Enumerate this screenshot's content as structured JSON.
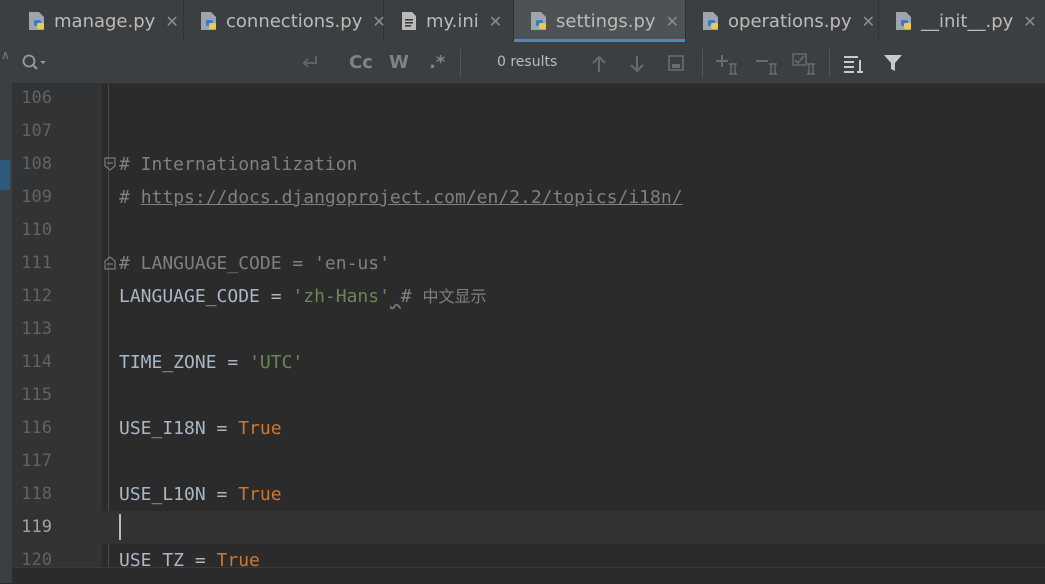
{
  "tabs": [
    {
      "label": "manage.py",
      "icon": "python-file-icon",
      "active": false
    },
    {
      "label": "connections.py",
      "icon": "python-file-icon",
      "active": false
    },
    {
      "label": "my.ini",
      "icon": "text-file-icon",
      "active": false
    },
    {
      "label": "settings.py",
      "icon": "python-file-icon",
      "active": true
    },
    {
      "label": "operations.py",
      "icon": "python-file-icon",
      "active": false
    },
    {
      "label": "__init__.py",
      "icon": "python-file-icon",
      "active": false
    }
  ],
  "search": {
    "results": "0 results",
    "options": {
      "match_case": "Cc",
      "words": "W",
      "regex": ".*"
    }
  },
  "editor": {
    "lines": [
      {
        "num": "106"
      },
      {
        "num": "107"
      },
      {
        "num": "108",
        "comment": "# Internationalization"
      },
      {
        "num": "109",
        "hash": "# ",
        "url": "https://docs.djangoproject.com/en/2.2/topics/i18n/"
      },
      {
        "num": "110"
      },
      {
        "num": "111",
        "comment": "# LANGUAGE_CODE = 'en-us'"
      },
      {
        "num": "112",
        "name": "LANGUAGE_CODE",
        "op": " = ",
        "str": "'zh-Hans'",
        "after": " ",
        "hash": "# ",
        "cjk": "中文显示"
      },
      {
        "num": "113"
      },
      {
        "num": "114",
        "name": "TIME_ZONE",
        "op": " = ",
        "str": "'UTC'"
      },
      {
        "num": "115"
      },
      {
        "num": "116",
        "name": "USE_I18N",
        "op": " = ",
        "kw": "True"
      },
      {
        "num": "117"
      },
      {
        "num": "118",
        "name": "USE_L10N",
        "op": " = ",
        "kw": "True"
      },
      {
        "num": "119"
      },
      {
        "num": "120",
        "name": "USE_TZ",
        "op": " = ",
        "kw": "True"
      }
    ]
  },
  "colors": {
    "accent": "#4a88c7",
    "keyword": "#cc7832",
    "string": "#6a8759",
    "comment": "#808080"
  }
}
